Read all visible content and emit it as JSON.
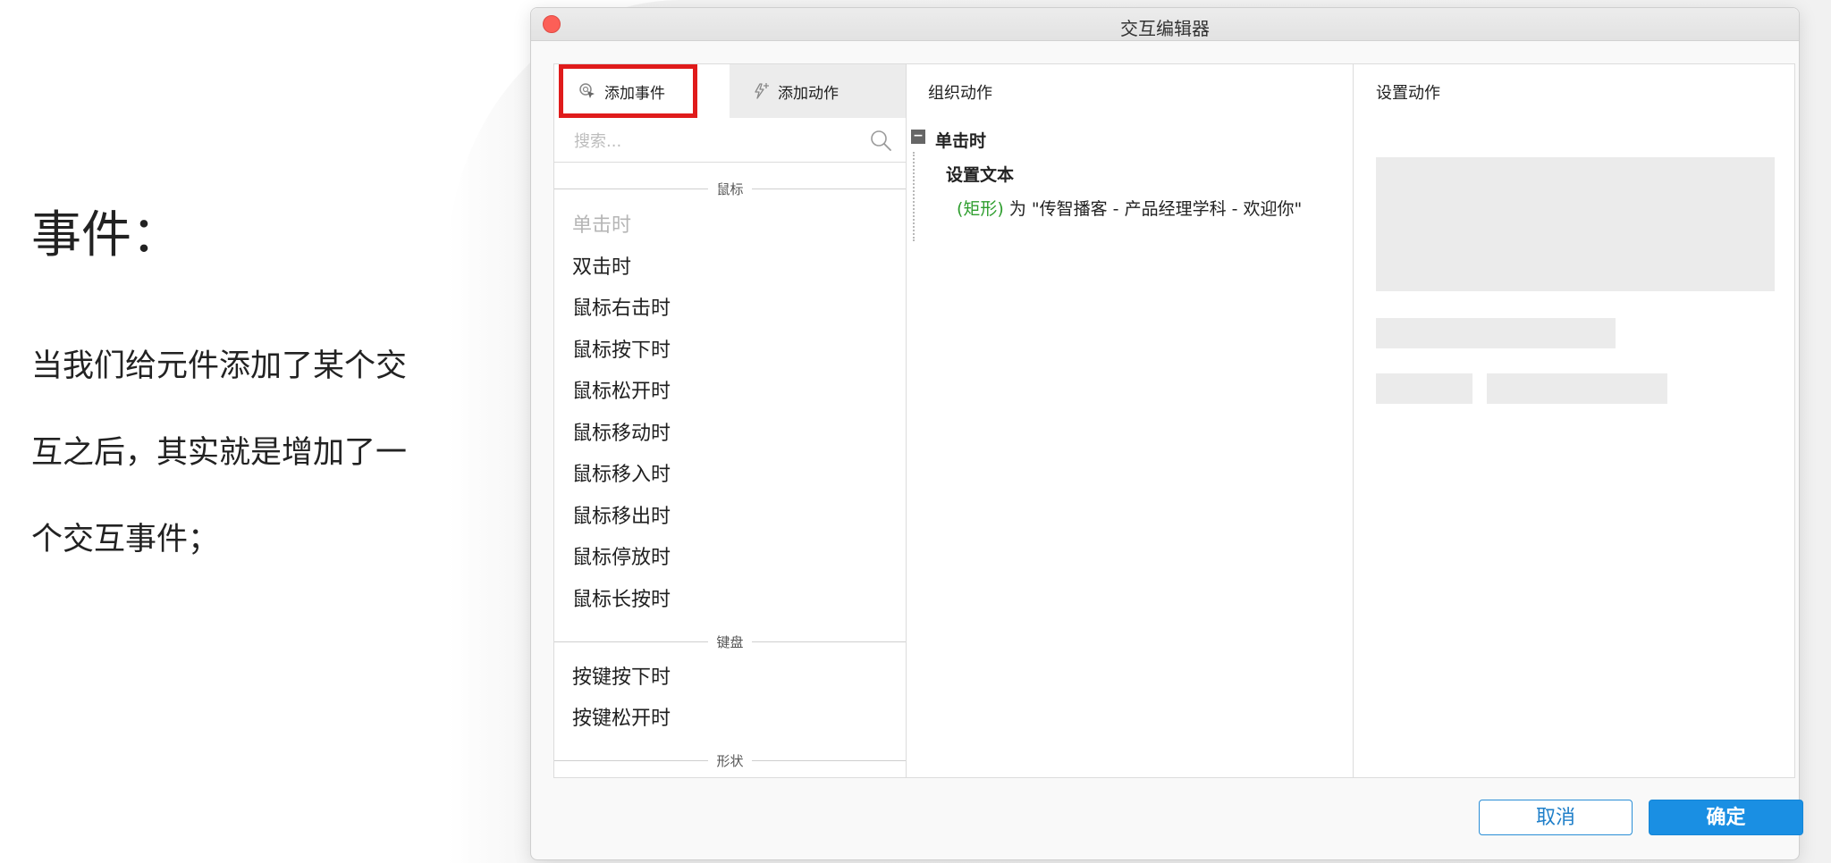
{
  "slide": {
    "title": "事件：",
    "paragraph": "当我们给元件添加了某个交互之后，其实就是增加了一个交互事件；"
  },
  "window": {
    "title": "交互编辑器"
  },
  "left_panel": {
    "tabs": [
      {
        "label": "添加事件",
        "icon": "add-event-icon"
      },
      {
        "label": "添加动作",
        "icon": "add-action-icon"
      }
    ],
    "search": {
      "placeholder": "搜索..."
    },
    "groups": {
      "mouse": "鼠标",
      "keyboard": "键盘",
      "shape": "形状"
    },
    "mouse_events": [
      "单击时",
      "双击时",
      "鼠标右击时",
      "鼠标按下时",
      "鼠标松开时",
      "鼠标移动时",
      "鼠标移入时",
      "鼠标移出时",
      "鼠标停放时",
      "鼠标长按时"
    ],
    "keyboard_events": [
      "按键按下时",
      "按键松开时"
    ]
  },
  "middle_panel": {
    "title": "组织动作",
    "tree": {
      "event": "单击时",
      "action": "设置文本",
      "target": "(矩形)",
      "detail": " 为 \"传智播客 - 产品经理学科 - 欢迎你\""
    }
  },
  "right_panel": {
    "title": "设置动作"
  },
  "buttons": {
    "cancel": "取消",
    "ok": "确定"
  },
  "colors": {
    "highlight_border": "#e01b1b",
    "primary_button": "#1a8fe3",
    "target_text": "#2f9e2f",
    "close_button": "#fc5f57"
  }
}
